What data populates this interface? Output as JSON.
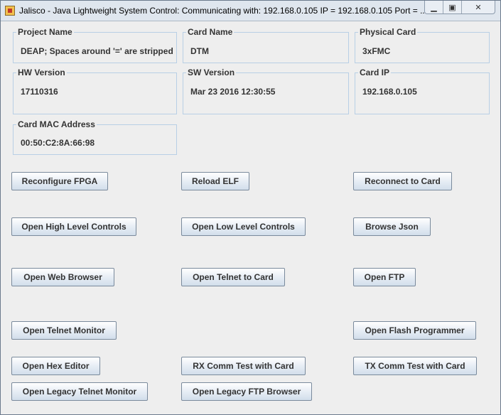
{
  "window": {
    "title": "Jalisco - Java Lightweight System Control: Communicating with: 192.168.0.105 IP = 192.168.0.105 Port = ...",
    "controls": {
      "minimize": "▁",
      "maximize": "▣",
      "close": "✕"
    }
  },
  "info": {
    "project_name": {
      "label": "Project Name",
      "value": "DEAP; Spaces around '=' are stripped"
    },
    "card_name": {
      "label": "Card Name",
      "value": "DTM"
    },
    "physical_card": {
      "label": "Physical Card",
      "value": "3xFMC"
    },
    "hw_version": {
      "label": "HW Version",
      "value": "17110316"
    },
    "sw_version": {
      "label": "SW Version",
      "value": "Mar 23 2016 12:30:55"
    },
    "card_ip": {
      "label": "Card IP",
      "value": "192.168.0.105"
    },
    "card_mac": {
      "label": "Card MAC Address",
      "value": "00:50:C2:8A:66:98"
    }
  },
  "buttons": {
    "reconfigure_fpga": "Reconfigure FPGA",
    "reload_elf": "Reload ELF",
    "reconnect": "Reconnect to Card",
    "open_high_level": "Open High Level Controls",
    "open_low_level": "Open Low Level Controls",
    "browse_json": "Browse Json",
    "open_web_browser": "Open Web Browser",
    "open_telnet_card": "Open Telnet to Card",
    "open_ftp": "Open FTP",
    "open_telnet_monitor": "Open Telnet Monitor",
    "open_flash_programmer": "Open Flash Programmer",
    "open_hex_editor": "Open Hex Editor",
    "rx_comm_test": "RX Comm Test with Card",
    "tx_comm_test": "TX Comm Test with Card",
    "open_legacy_telnet": "Open Legacy Telnet Monitor",
    "open_legacy_ftp": "Open Legacy FTP Browser"
  }
}
